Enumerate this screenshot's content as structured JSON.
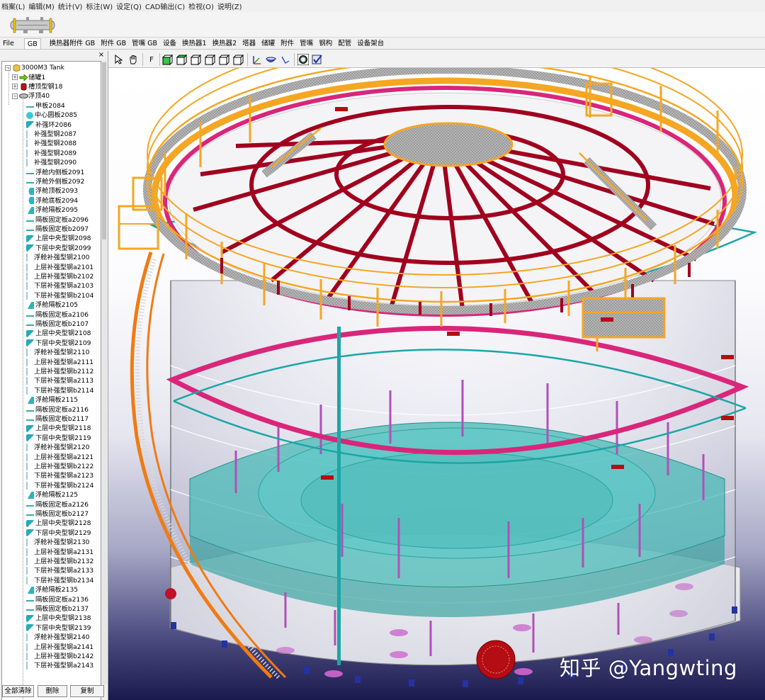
{
  "menubar": {
    "items": [
      "档案(L)",
      "编辑(M)",
      "统计(V)",
      "标注(W)",
      "设定(Q)",
      "CAD输出(C)",
      "检视(O)",
      "说明(Z)"
    ]
  },
  "category_tabs": [
    "File",
    "GB",
    "换热器附件 GB",
    "附件 GB",
    "管嘴 GB",
    "设备",
    "换热器1",
    "换热器2",
    "塔器",
    "储罐",
    "附件",
    "管嘴",
    "钢构",
    "配管",
    "设备架台"
  ],
  "panel": {
    "close_label": "×"
  },
  "tree": {
    "root": "3000M3 Tank",
    "level1": [
      "储罐1",
      "槽顶型钢18",
      "浮顶40"
    ],
    "children": [
      {
        "label": "甲板2084",
        "icon": "plate"
      },
      {
        "label": "中心圆板2085",
        "icon": "disk"
      },
      {
        "label": "补强环2086",
        "icon": "ring"
      },
      {
        "label": "补强型钢2087",
        "icon": "beam"
      },
      {
        "label": "补强型钢2088",
        "icon": "beam"
      },
      {
        "label": "补强型钢2089",
        "icon": "beam"
      },
      {
        "label": "补强型钢2090",
        "icon": "beam"
      },
      {
        "label": "浮舱内侧板2091",
        "icon": "plate"
      },
      {
        "label": "浮舱外侧板2092",
        "icon": "plate"
      },
      {
        "label": "浮舱顶板2093",
        "icon": "semidisk"
      },
      {
        "label": "浮舱底板2094",
        "icon": "semidisk"
      },
      {
        "label": "浮舱隔板2095",
        "icon": "diaph"
      },
      {
        "label": "隔板固定板a2096",
        "icon": "plate"
      },
      {
        "label": "隔板固定板b2097",
        "icon": "plate"
      },
      {
        "label": "上层中央型钢2098",
        "icon": "ring"
      },
      {
        "label": "下层中央型钢2099",
        "icon": "ring"
      },
      {
        "label": "浮舱补强型钢2100",
        "icon": "beam"
      },
      {
        "label": "上层补强型钢a2101",
        "icon": "beam"
      },
      {
        "label": "上层补强型钢b2102",
        "icon": "beam"
      },
      {
        "label": "下层补强型钢a2103",
        "icon": "beam"
      },
      {
        "label": "下层补强型钢b2104",
        "icon": "beam"
      },
      {
        "label": "浮舱隔板2105",
        "icon": "diaph"
      },
      {
        "label": "隔板固定板a2106",
        "icon": "plate"
      },
      {
        "label": "隔板固定板b2107",
        "icon": "plate"
      },
      {
        "label": "上层中央型钢2108",
        "icon": "ring"
      },
      {
        "label": "下层中央型钢2109",
        "icon": "ring"
      },
      {
        "label": "浮舱补强型钢2110",
        "icon": "beam"
      },
      {
        "label": "上层补强型钢a2111",
        "icon": "beam"
      },
      {
        "label": "上层补强型钢b2112",
        "icon": "beam"
      },
      {
        "label": "下层补强型钢a2113",
        "icon": "beam"
      },
      {
        "label": "下层补强型钢b2114",
        "icon": "beam"
      },
      {
        "label": "浮舱隔板2115",
        "icon": "diaph"
      },
      {
        "label": "隔板固定板a2116",
        "icon": "plate"
      },
      {
        "label": "隔板固定板b2117",
        "icon": "plate"
      },
      {
        "label": "上层中央型钢2118",
        "icon": "ring"
      },
      {
        "label": "下层中央型钢2119",
        "icon": "ring"
      },
      {
        "label": "浮舱补强型钢2120",
        "icon": "beam"
      },
      {
        "label": "上层补强型钢a2121",
        "icon": "beam"
      },
      {
        "label": "上层补强型钢b2122",
        "icon": "beam"
      },
      {
        "label": "下层补强型钢a2123",
        "icon": "beam"
      },
      {
        "label": "下层补强型钢b2124",
        "icon": "beam"
      },
      {
        "label": "浮舱隔板2125",
        "icon": "diaph"
      },
      {
        "label": "隔板固定板a2126",
        "icon": "plate"
      },
      {
        "label": "隔板固定板b2127",
        "icon": "plate"
      },
      {
        "label": "上层中央型钢2128",
        "icon": "ring"
      },
      {
        "label": "下层中央型钢2129",
        "icon": "ring"
      },
      {
        "label": "浮舱补强型钢2130",
        "icon": "beam"
      },
      {
        "label": "上层补强型钢a2131",
        "icon": "beam"
      },
      {
        "label": "上层补强型钢b2132",
        "icon": "beam"
      },
      {
        "label": "下层补强型钢a2133",
        "icon": "beam"
      },
      {
        "label": "下层补强型钢b2134",
        "icon": "beam"
      },
      {
        "label": "浮舱隔板2135",
        "icon": "diaph"
      },
      {
        "label": "隔板固定板a2136",
        "icon": "plate"
      },
      {
        "label": "隔板固定板b2137",
        "icon": "plate"
      },
      {
        "label": "上层中央型钢2138",
        "icon": "ring"
      },
      {
        "label": "下层中央型钢2139",
        "icon": "ring"
      },
      {
        "label": "浮舱补强型钢2140",
        "icon": "beam"
      },
      {
        "label": "上层补强型钢a2141",
        "icon": "beam"
      },
      {
        "label": "上层补强型钢b2142",
        "icon": "beam"
      },
      {
        "label": "下层补强型钢a2143",
        "icon": "beam"
      }
    ]
  },
  "buttons": {
    "clear_all": "全部清除",
    "delete": "删除",
    "copy": "复制"
  },
  "view_toolbar": {
    "f_label": "F"
  },
  "watermark": "知乎 @Yangwting",
  "colors": {
    "platform": "#f5a623",
    "rafter": "#a0001e",
    "pontoon": "#3fbfbf",
    "wind_girder": "#d9267a",
    "stair": "#f07b14"
  }
}
